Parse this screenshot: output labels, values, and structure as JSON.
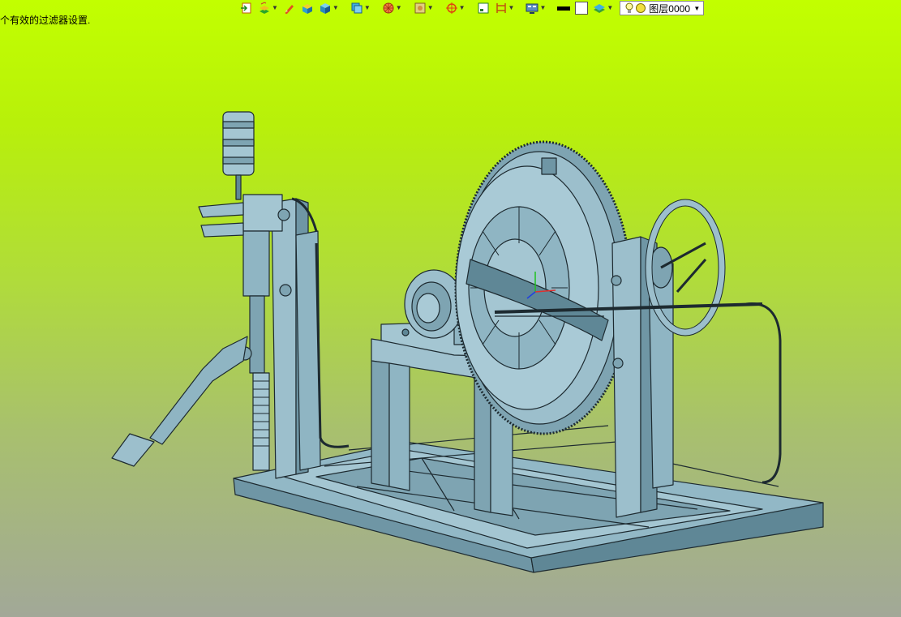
{
  "status_message": "个有效的过滤器设置.",
  "layer": {
    "name": "图层0000"
  },
  "toolbar": {
    "icons": [
      "import-icon",
      "layers-icon",
      "pencil-icon",
      "block-icon",
      "box-icon",
      "view-cube-icon",
      "render-style-icon",
      "texture-icon",
      "snap-icon",
      "frame-icon",
      "dimension-icon",
      "display-icon",
      "line-color-swatch",
      "fill-color-swatch",
      "layer-stack-icon",
      "lightbulb-icon",
      "circle-icon"
    ]
  },
  "colors": {
    "model": "#8fb5c3",
    "model_dark": "#5f8796",
    "outline": "#1d2a30",
    "background_top": "#c2ff00",
    "background_bottom": "#a2a898"
  }
}
